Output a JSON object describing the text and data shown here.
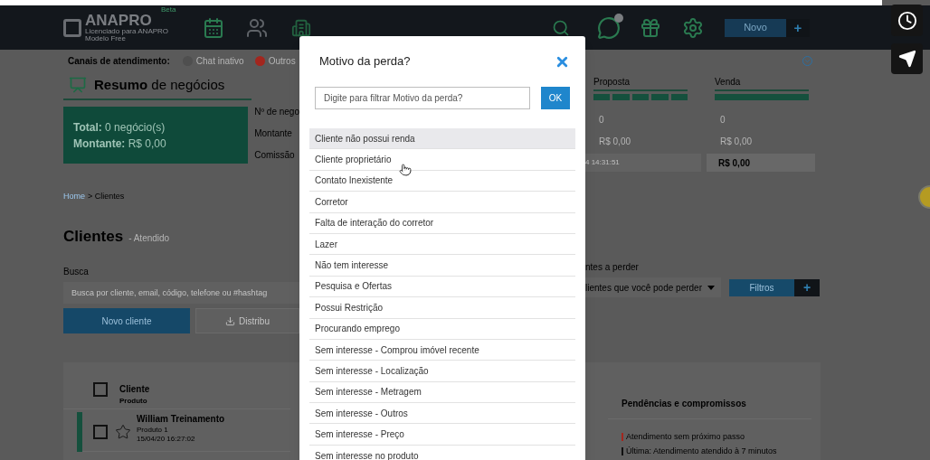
{
  "header": {
    "logo": "ANAPRO",
    "logo_badge": "Beta",
    "license": "Licenciado para ANAPRO",
    "plan": "Modelo Free",
    "new_button": "Novo",
    "add_button": "+"
  },
  "channels": {
    "label": "Canais de atendimento:",
    "items": [
      {
        "label": "Chat inativo",
        "color": "#4f4f4f"
      },
      {
        "label": "Outros",
        "color": "#a3261e"
      }
    ]
  },
  "summary": {
    "title": "**Resumo** de negócios",
    "total": "**Total:** 0 negócio(s)",
    "amount": "**Montante:** R$ 0,00",
    "row_labels": [
      "Nº de nego",
      "Montante",
      "Comissão"
    ],
    "stages": [
      {
        "name": "Proposta",
        "kind": "segmented",
        "count": "0",
        "amount": "R$ 0,00",
        "commission": "4 14:31:51"
      },
      {
        "name": "Venda",
        "kind": "solid",
        "count": "0",
        "amount": "R$ 0,00",
        "commission": "R$ 0,00"
      }
    ]
  },
  "breadcrumb": {
    "home": "Home",
    "current": "> Clientes"
  },
  "page": {
    "title": "Clientes",
    "subtitle": "- Atendido"
  },
  "search": {
    "label": "Busca",
    "placeholder": "Busca por cliente, email, código, telefone ou #hashtag"
  },
  "actions": {
    "new_client": "Novo cliente",
    "distribute": "Distribu"
  },
  "lose_filter": {
    "label": "ntes a perder",
    "value": "lientes que você pode perder"
  },
  "filters": {
    "label": "Filtros",
    "add": "+"
  },
  "table": {
    "header": {
      "title": "Cliente",
      "subtitle": "Produto",
      "checked": false
    },
    "rows": [
      {
        "name": "William Treinamento",
        "product": "Produto 1",
        "date": "15/04/20 16:27:02",
        "checked": false,
        "starred": false
      }
    ]
  },
  "pending": {
    "title": "Pendências e compromissos",
    "items": [
      {
        "text": "Atendimento sem próximo passo",
        "color": "#a3261e"
      },
      {
        "text": "Última: Atendimento atendido à 7 minutos",
        "color": "#111111"
      }
    ]
  },
  "modal": {
    "title": "Motivo da perda?",
    "filter_placeholder": "Digite para filtrar Motivo da perda?",
    "ok": "OK",
    "options": [
      {
        "label": "Cliente não possui renda",
        "selected": true
      },
      {
        "label": "Cliente proprietário",
        "selected": false
      },
      {
        "label": "Contato Inexistente",
        "selected": false
      },
      {
        "label": "Corretor",
        "selected": false
      },
      {
        "label": "Falta de interação do corretor",
        "selected": false
      },
      {
        "label": "Lazer",
        "selected": false
      },
      {
        "label": "Não tem interesse",
        "selected": false
      },
      {
        "label": "Pesquisa e Ofertas",
        "selected": false
      },
      {
        "label": "Possui Restrição",
        "selected": false
      },
      {
        "label": "Procurando emprego",
        "selected": false
      },
      {
        "label": "Sem interesse - Comprou imóvel recente",
        "selected": false
      },
      {
        "label": "Sem interesse - Localização",
        "selected": false
      },
      {
        "label": "Sem interesse - Metragem",
        "selected": false
      },
      {
        "label": "Sem interesse - Outros",
        "selected": false
      },
      {
        "label": "Sem interesse - Preço",
        "selected": false
      },
      {
        "label": "Sem interesse no produto",
        "selected": false
      }
    ]
  }
}
